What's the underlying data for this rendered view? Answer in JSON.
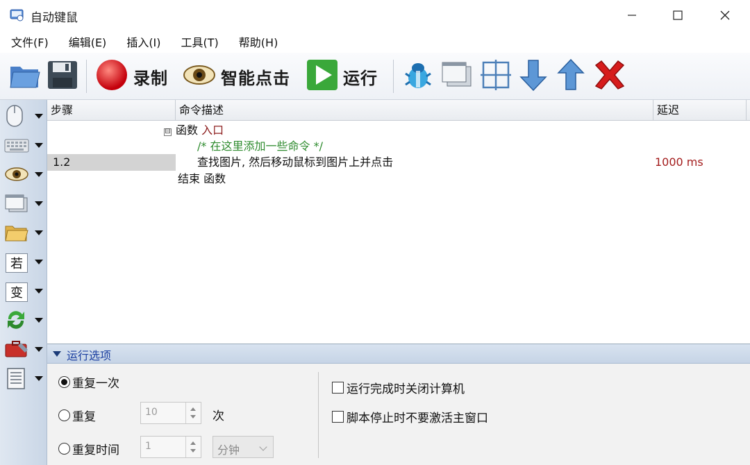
{
  "window": {
    "title": "自动键鼠"
  },
  "menu": [
    "文件(F)",
    "编辑(E)",
    "插入(I)",
    "工具(T)",
    "帮助(H)"
  ],
  "toolbar": {
    "record_label": "录制",
    "smart_click_label": "智能点击",
    "run_label": "运行"
  },
  "grid": {
    "col_step": "步骤",
    "col_desc": "命令描述",
    "col_delay": "延迟",
    "tree_toggle": "⊟",
    "func_kw": "函数",
    "func_name": "入口",
    "comment": "/* 在这里添加一些命令 */",
    "step": "1.2",
    "command": "查找图片, 然后移动鼠标到图片上并点击",
    "delay": "1000 ms",
    "end_kw": "结束 函数"
  },
  "leftbar": {
    "if_char": "若",
    "var_char": "变"
  },
  "options": {
    "header": "运行选项",
    "repeat_once": "重复一次",
    "repeat": "重复",
    "repeat_count": "10",
    "repeat_unit": "次",
    "repeat_time": "重复时间",
    "time_value": "1",
    "time_unit": "分钟",
    "shutdown_check": "运行完成时关闭计算机",
    "no_activate_check": "脚本停止时不要激活主窗口",
    "selected": "repeat_once"
  },
  "colors": {
    "accent": "#1b3fa0",
    "comment": "#2e8b2e",
    "delay": "#a31c1c",
    "func_name": "#8b1a1a"
  }
}
